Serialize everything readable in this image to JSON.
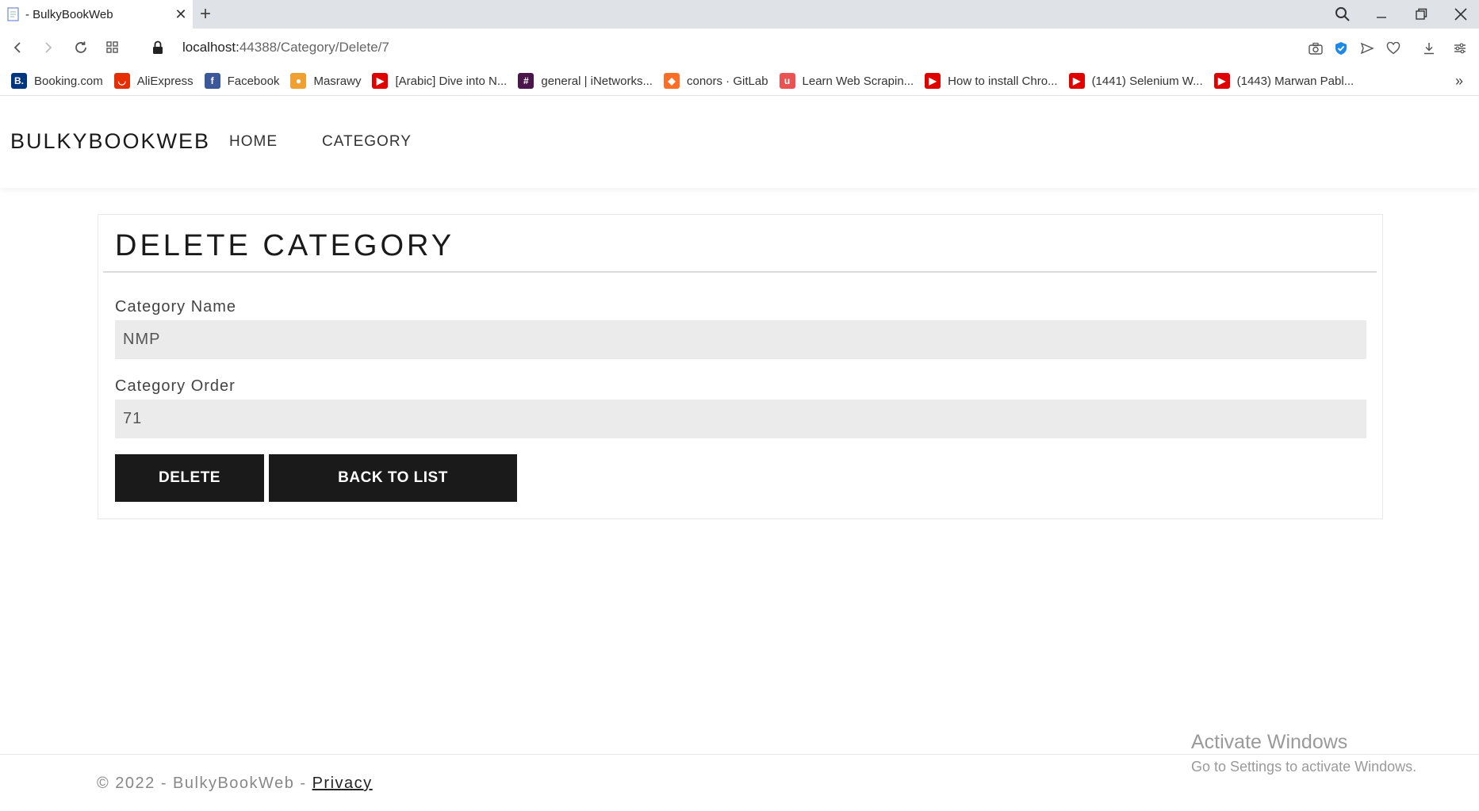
{
  "browser": {
    "tab_title": "- BulkyBookWeb",
    "close_glyph": "✕",
    "new_tab_glyph": "+",
    "url_host": "localhost:",
    "url_rest": "44388/Category/Delete/7"
  },
  "bookmarks": [
    {
      "label": "Booking.com",
      "icon": "booking-icon",
      "color": "#003580",
      "glyph": "B."
    },
    {
      "label": "AliExpress",
      "icon": "aliexpress-icon",
      "color": "#e62e04",
      "glyph": "◡"
    },
    {
      "label": "Facebook",
      "icon": "facebook-icon",
      "color": "#3b5998",
      "glyph": "f"
    },
    {
      "label": "Masrawy",
      "icon": "masrawy-icon",
      "color": "#f0a030",
      "glyph": "●"
    },
    {
      "label": "[Arabic] Dive into N...",
      "icon": "youtube-icon",
      "color": "#e00000",
      "glyph": "▶"
    },
    {
      "label": "general | iNetworks...",
      "icon": "slack-icon",
      "color": "#4a154b",
      "glyph": "#"
    },
    {
      "label": "conors · GitLab",
      "icon": "gitlab-icon",
      "color": "#fc6d26",
      "glyph": "◆"
    },
    {
      "label": "Learn Web Scrapin...",
      "icon": "udemy-icon",
      "color": "#ec5252",
      "glyph": "u"
    },
    {
      "label": "How to install Chro...",
      "icon": "youtube-icon",
      "color": "#e00000",
      "glyph": "▶"
    },
    {
      "label": "(1441) Selenium W...",
      "icon": "youtube-icon",
      "color": "#e00000",
      "glyph": "▶"
    },
    {
      "label": "(1443) Marwan Pabl...",
      "icon": "youtube-icon",
      "color": "#e00000",
      "glyph": "▶"
    }
  ],
  "bookmarks_more": "»",
  "site": {
    "brand": "BULKYBOOKWEB",
    "nav": {
      "home": "HOME",
      "category": "CATEGORY"
    }
  },
  "form": {
    "title": "DELETE CATEGORY",
    "name_label": "Category Name",
    "name_value": "NMP",
    "order_label": "Category Order",
    "order_value": "71",
    "delete_label": "DELETE",
    "back_label": "BACK TO LIST"
  },
  "footer": {
    "text": "© 2022 - BulkyBookWeb - ",
    "privacy": "Privacy"
  },
  "watermark": {
    "line1": "Activate Windows",
    "line2": "Go to Settings to activate Windows."
  }
}
